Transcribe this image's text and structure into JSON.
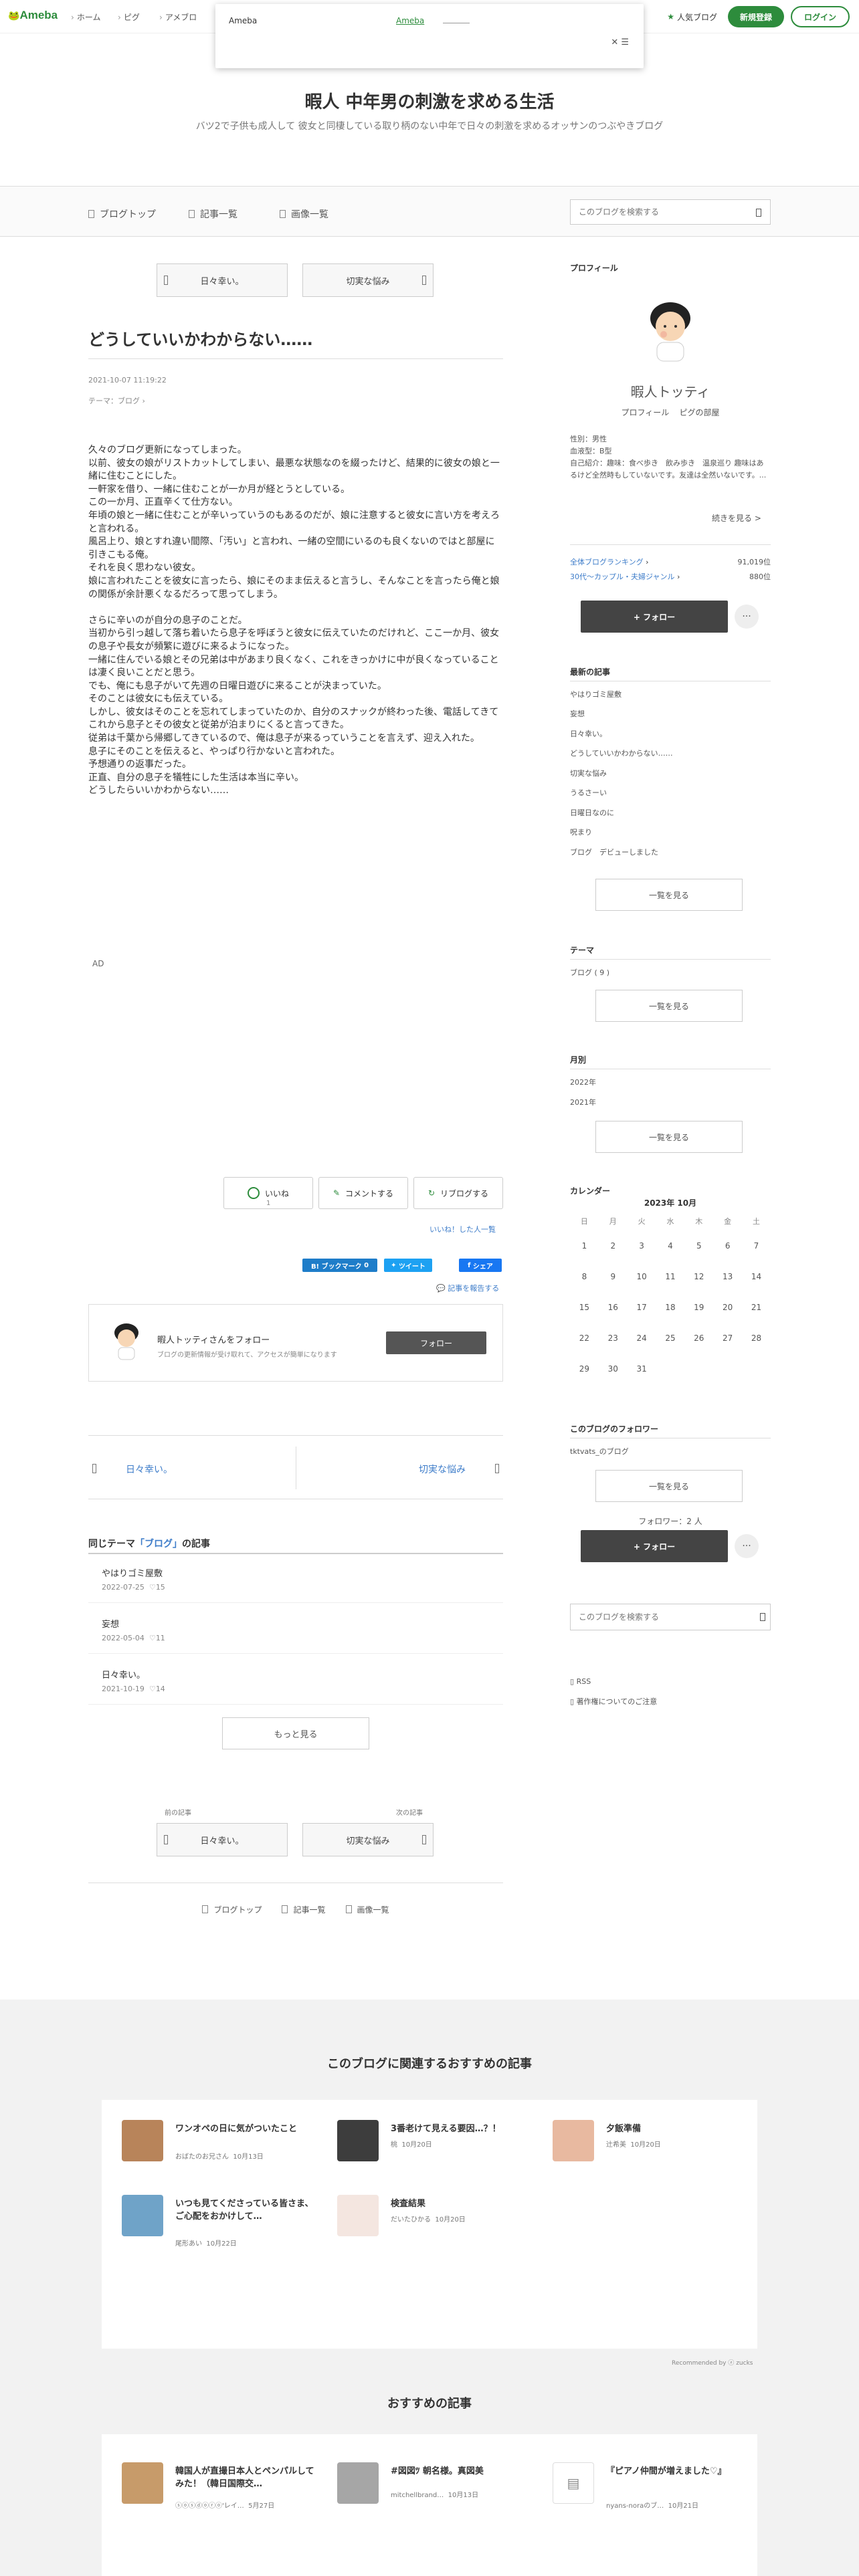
{
  "topbar": {
    "logo": "Ameba",
    "nav": [
      "ホーム",
      "ピグ",
      "アメブロ"
    ],
    "popular": "人気ブログ",
    "register": "新規登録",
    "login": "ログイン"
  },
  "dropdown": {
    "label": "Ameba",
    "link": "Ameba",
    "close": "✕ ☰"
  },
  "header": {
    "title": "暇人 中年男の刺激を求める生活",
    "description": "バツ2で子供も成人して 彼女と同棲している取り柄のない中年で日々の刺激を求めるオッサンのつぶやきブログ"
  },
  "nav": {
    "top": "ブログトップ",
    "list": "記事一覧",
    "images": "画像一覧",
    "search_placeholder": "このブログを検索する"
  },
  "pager_top": {
    "prev": "日々幸い。",
    "next": "切実な悩み"
  },
  "article": {
    "title": "どうしていいかわからない……",
    "date": "2021-10-07 11:19:22",
    "theme_label": "テーマ：",
    "theme": "ブログ",
    "body": [
      "久々のブログ更新になってしまった。",
      "以前、彼女の娘がリストカットしてしまい、最悪な状態なのを綴ったけど、結果的に彼女の娘と一緒に住むことにした。",
      "一軒家を借り、一緒に住むことが一か月が経とうとしている。",
      "この一か月、正直辛くて仕方ない。",
      "年頃の娘と一緒に住むことが辛いっていうのもあるのだが、娘に注意すると彼女に言い方を考えろと言われる。",
      "風呂上り、娘とすれ違い間際、「汚い」と言われ、一緒の空間にいるのも良くないのではと部屋に引きこもる俺。",
      "それを良く思わない彼女。",
      "娘に言われたことを彼女に言ったら、娘にそのまま伝えると言うし、そんなことを言ったら俺と娘の関係が余計悪くなるだろって思ってしまう。",
      "",
      "さらに辛いのが自分の息子のことだ。",
      "当初から引っ越して落ち着いたら息子を呼ぼうと彼女に伝えていたのだけれど、ここ一か月、彼女の息子や長女が頻繁に遊びに来るようになった。",
      "一緒に住んでいる娘とその兄弟は中があまり良くなく、これをきっかけに中が良くなっていることは凄く良いことだと思う。",
      "でも、俺にも息子がいて先週の日曜日遊びに来ることが決まっていた。",
      "そのことは彼女にも伝えている。",
      "しかし、彼女はそのことを忘れてしまっていたのか、自分のスナックが終わった後、電話してきてこれから息子とその彼女と従弟が泊まりにくると言ってきた。",
      "従弟は千葉から帰郷してきているので、俺は息子が来るっていうことを言えず、迎え入れた。",
      "息子にそのことを伝えると、やっぱり行かないと言われた。",
      "予想通りの返事だった。",
      "正直、自分の息子を犠牲にした生活は本当に辛い。",
      "どうしたらいいかわからない……"
    ],
    "ad_label": "AD"
  },
  "reactions": {
    "like": "いいね",
    "like_count": "1",
    "comment": "コメントする",
    "reblog": "リブログする",
    "liked_list": "いいね！した人一覧"
  },
  "share": {
    "hatena": "B! ブックマーク",
    "hatena_count": "0",
    "tweet": "ツイート",
    "fb": "シェア",
    "report": "記事を報告する"
  },
  "follow_box": {
    "name": "暇人トッティさんをフォロー",
    "sub": "ブログの更新情報が受け取れて、アクセスが簡単になります",
    "button": "フォロー"
  },
  "prevnext": {
    "prev": "日々幸い。",
    "next": "切実な悩み"
  },
  "same_theme": {
    "prefix": "同じテーマ",
    "theme": "「ブログ」",
    "suffix": "の記事",
    "items": [
      {
        "title": "やはりゴミ屋敷",
        "date": "2022-07-25",
        "count": "15"
      },
      {
        "title": "妄想",
        "date": "2022-05-04",
        "count": "11"
      },
      {
        "title": "日々幸い。",
        "date": "2021-10-19",
        "count": "14"
      }
    ],
    "more": "もっと見る"
  },
  "pager_bottom": {
    "prev_label": "前の記事",
    "next_label": "次の記事",
    "prev": "日々幸い。",
    "next": "切実な悩み"
  },
  "sidebar": {
    "profile_heading": "プロフィール",
    "name": "暇人トッティ",
    "links": [
      "プロフィール",
      "ピグの部屋"
    ],
    "info": [
      "性別：男性",
      "血液型：B型",
      "自己紹介：趣味：食べ歩き　飲み歩き　温泉巡り 趣味はあるけど全然時もしていないです。友達は全然いないです。..."
    ],
    "more": "続きを見る >",
    "rankings": [
      {
        "label": "全体ブログランキング",
        "value": "91,019位"
      },
      {
        "label": "30代〜カップル・夫婦ジャンル",
        "value": "880位"
      }
    ],
    "follow": "+ フォロー",
    "dots": "···",
    "recent_heading": "最新の記事",
    "recent": [
      "やはりゴミ屋敷",
      "妄想",
      "日々幸い。",
      "どうしていいかわからない……",
      "切実な悩み",
      "うるさーい",
      "日曜日なのに",
      "呪まり",
      "ブログ　デビューしました"
    ],
    "list_all": "一覧を見る",
    "theme_heading": "テーマ",
    "themes": [
      "ブログ ( 9 )"
    ],
    "month_heading": "月別",
    "months": [
      "2022年",
      "2021年"
    ],
    "calendar_heading": "カレンダー",
    "calendar_month": "2023年 10月",
    "weekdays": [
      "日",
      "月",
      "火",
      "水",
      "木",
      "金",
      "土"
    ],
    "weeks": [
      [
        "1",
        "2",
        "3",
        "4",
        "5",
        "6",
        "7"
      ],
      [
        "8",
        "9",
        "10",
        "11",
        "12",
        "13",
        "14"
      ],
      [
        "15",
        "16",
        "17",
        "18",
        "19",
        "20",
        "21"
      ],
      [
        "22",
        "23",
        "24",
        "25",
        "26",
        "27",
        "28"
      ],
      [
        "29",
        "30",
        "31",
        "",
        "",
        "",
        ""
      ]
    ],
    "followers_heading": "このブログのフォロワー",
    "follower": "tktvats_のブログ",
    "follower_count": "フォロワー：2 人",
    "search_placeholder": "このブログを検索する",
    "rss": "RSS",
    "copyright": "著作権についてのご注意"
  },
  "recommend": {
    "title": "このブログに関連するおすすめの記事",
    "items": [
      {
        "title": "ワンオペの日に気がついたこと",
        "author": "おばたのお兄さん",
        "date": "10月13日",
        "color": "#b8845a"
      },
      {
        "title": "3番老けて見える要因…？！",
        "author": "桃",
        "date": "10月20日",
        "color": "#3d3d3d"
      },
      {
        "title": "夕飯準備",
        "author": "辻希美",
        "date": "10月20日",
        "color": "#e8b9a0"
      },
      {
        "title": "いつも見てくださっている皆さま、ご心配をおかけして…",
        "author": "尾形あい",
        "date": "10月22日",
        "color": "#6fa3c8"
      },
      {
        "title": "検査結果",
        "author": "だいたひかる",
        "date": "10月20日",
        "color": "#f4e6e0"
      }
    ],
    "powered": "Recommended by ⓩ zucks"
  },
  "osusume": {
    "title": "おすすめの記事",
    "items": [
      {
        "title": "韓国人が直撮日本人とペンパルしてみた！（韓日国際交…",
        "author": "ⓢⓞⓢⓓⓞⓡⓞ'レイ…",
        "date": "5月27日",
        "color": "#c79b6a"
      },
      {
        "title": "#図図ﾂ 朝名様。真図美",
        "author": "mitchellbrand…",
        "date": "10月13日",
        "color": "#a6a6a6"
      },
      {
        "title": "『ピアノ仲間が増えました♡』",
        "author": "nyans-noraのブ…",
        "date": "10月21日",
        "color": "#ffffff"
      }
    ]
  }
}
